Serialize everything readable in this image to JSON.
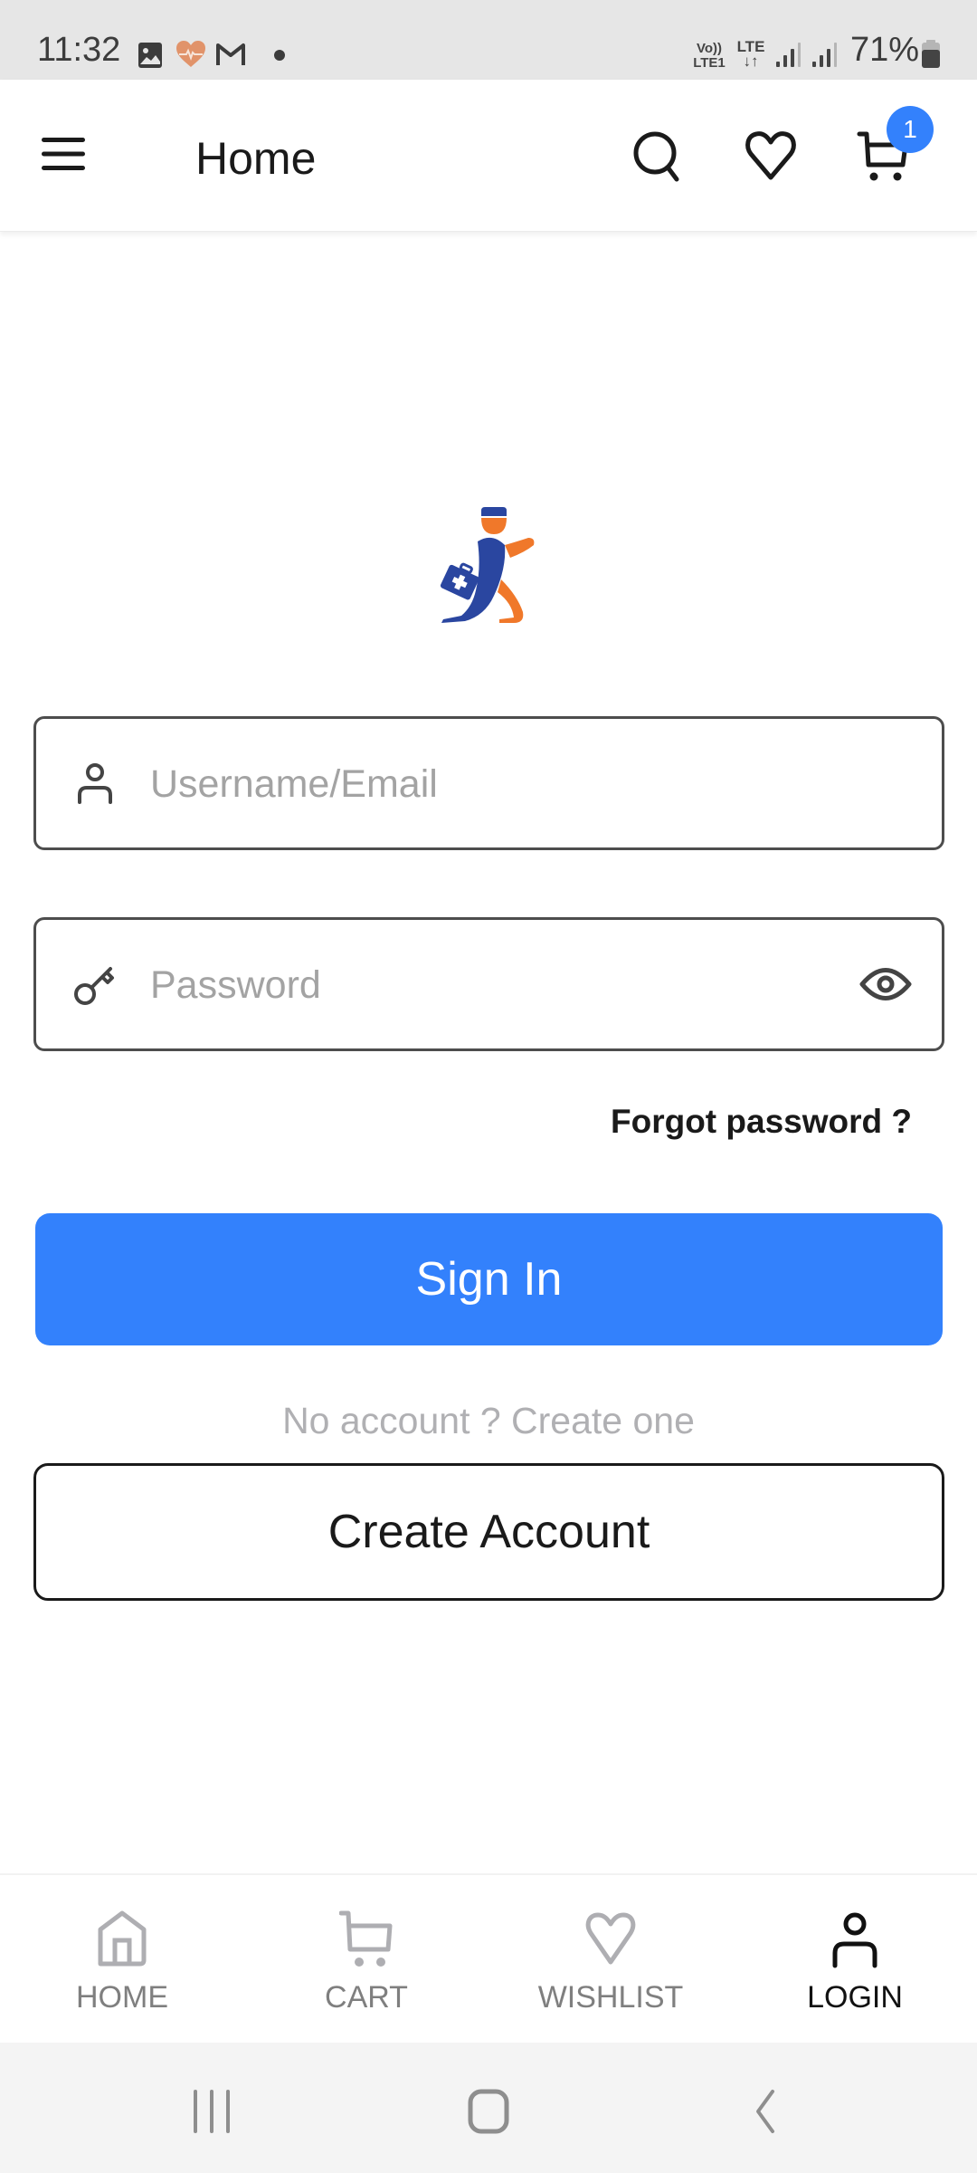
{
  "status_bar": {
    "time": "11:32",
    "notification_icons": [
      "gallery-icon",
      "health-heart-icon",
      "gmail-icon",
      "more-dot-icon"
    ],
    "volte_label_top": "Vo))",
    "volte_label_bottom": "LTE1",
    "lte_label": "LTE",
    "lte_arrows": "↓↑",
    "battery_percent": "71%"
  },
  "header": {
    "title": "Home",
    "cart_badge_count": "1",
    "icons": [
      "menu-icon",
      "search-icon",
      "heart-icon",
      "cart-icon"
    ]
  },
  "login_form": {
    "username_placeholder": "Username/Email",
    "username_value": "",
    "password_placeholder": "Password",
    "password_value": "",
    "forgot_password_label": "Forgot password ?",
    "sign_in_label": "Sign In",
    "no_account_text": "No account ? Create one",
    "create_account_label": "Create Account"
  },
  "bottom_nav": {
    "items": [
      {
        "label": "HOME",
        "icon": "home-icon",
        "active": false
      },
      {
        "label": "CART",
        "icon": "cart-icon",
        "active": false
      },
      {
        "label": "WISHLIST",
        "icon": "heart-icon",
        "active": false
      },
      {
        "label": "LOGIN",
        "icon": "user-icon",
        "active": true
      }
    ]
  },
  "colors": {
    "accent": "#3381fc",
    "logo_blue": "#2a46a0",
    "logo_orange": "#f0782a",
    "placeholder": "#a3a3a3",
    "muted_text": "#b0b0b3"
  }
}
